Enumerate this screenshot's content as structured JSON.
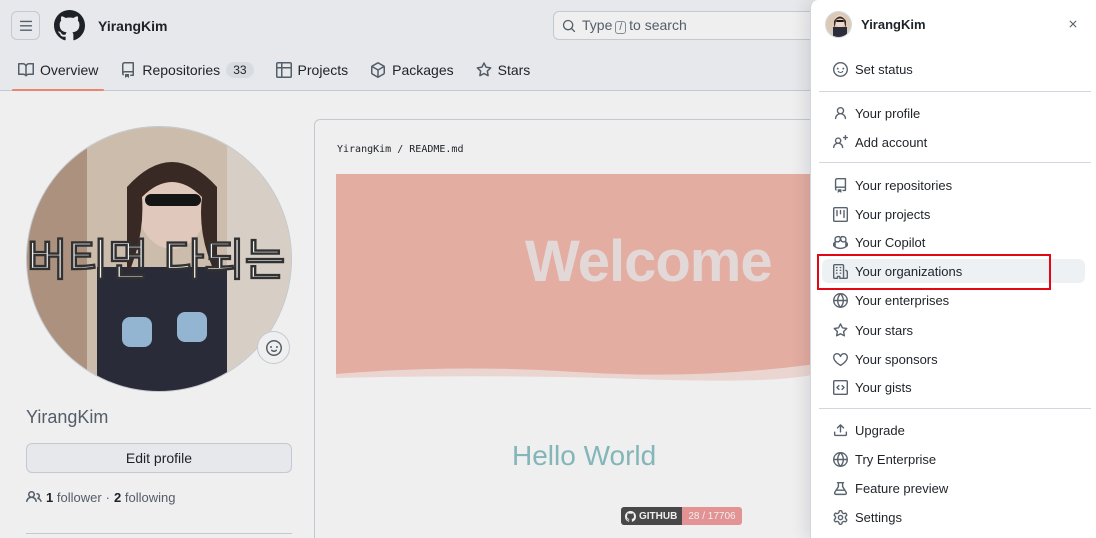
{
  "header": {
    "username": "YirangKim",
    "search_placeholder_prefix": "Type",
    "search_key": "/",
    "search_placeholder_suffix": "to search"
  },
  "tabs": [
    {
      "label": "Overview"
    },
    {
      "label": "Repositories",
      "count": "33"
    },
    {
      "label": "Projects"
    },
    {
      "label": "Packages"
    },
    {
      "label": "Stars"
    }
  ],
  "profile": {
    "name": "YirangKim",
    "edit_label": "Edit profile",
    "followers_count": "1",
    "followers_label": "follower",
    "separator": "·",
    "following_count": "2",
    "following_label": "following"
  },
  "readme": {
    "path_user": "YirangKim",
    "path_sep": "/",
    "path_file": "README.md",
    "banner_text": "Welcome",
    "banner_overlay_text": "버티면 다되는",
    "hello": "Hello World",
    "badge_label": "GITHUB",
    "badge_value": "28 / 17706"
  },
  "menu": {
    "username": "YirangKim",
    "items": [
      {
        "label": "Set status",
        "icon": "smiley-icon"
      },
      {
        "label": "Your profile",
        "icon": "person-icon"
      },
      {
        "label": "Add account",
        "icon": "person-add-icon"
      },
      {
        "label": "Your repositories",
        "icon": "repo-icon"
      },
      {
        "label": "Your projects",
        "icon": "project-icon"
      },
      {
        "label": "Your Copilot",
        "icon": "copilot-icon"
      },
      {
        "label": "Your organizations",
        "icon": "organization-icon"
      },
      {
        "label": "Your enterprises",
        "icon": "globe-icon"
      },
      {
        "label": "Your stars",
        "icon": "star-icon"
      },
      {
        "label": "Your sponsors",
        "icon": "heart-icon"
      },
      {
        "label": "Your gists",
        "icon": "code-square-icon"
      },
      {
        "label": "Upgrade",
        "icon": "upload-icon"
      },
      {
        "label": "Try Enterprise",
        "icon": "globe-icon"
      },
      {
        "label": "Feature preview",
        "icon": "beaker-icon"
      },
      {
        "label": "Settings",
        "icon": "gear-icon"
      }
    ]
  },
  "colors": {
    "accent_tab": "#fd8c73",
    "highlight_box": "#e30613",
    "banner_bg": "#f4b8ac",
    "hello_text": "#8bc2c3"
  }
}
